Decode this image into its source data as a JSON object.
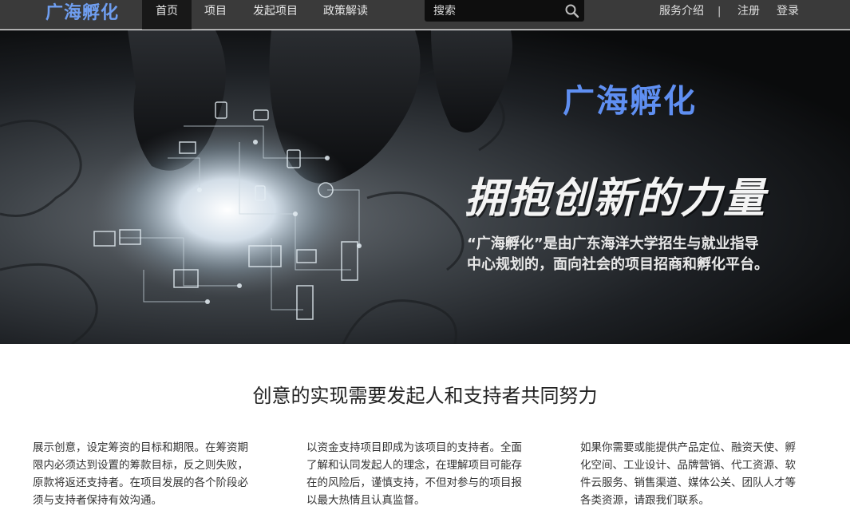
{
  "nav": {
    "logo": "广海孵化",
    "items": [
      {
        "label": "首页",
        "active": true
      },
      {
        "label": "项目",
        "active": false
      },
      {
        "label": "发起项目",
        "active": false
      },
      {
        "label": "政策解读",
        "active": false
      }
    ],
    "search_placeholder": "搜索",
    "right": {
      "about": "服务介绍",
      "divider": "|",
      "register": "注册",
      "login": "登录"
    }
  },
  "hero": {
    "brand": "广海孵化",
    "slogan": "拥抱创新的力量",
    "description_line1": "“广海孵化”是由广东海洋大学招生与就业指导",
    "description_line2": "中心规划的，面向社会的项目招商和孵化平台。"
  },
  "content": {
    "title": "创意的实现需要发起人和支持者共同努力",
    "columns": [
      "展示创意，设定筹资的目标和期限。在筹资期限内必须达到设置的筹款目标，反之则失败，原款将返还支持者。在项目发展的各个阶段必须与支持者保持有效沟通。",
      "以资金支持项目即成为该项目的支持者。全面了解和认同发起人的理念，在理解项目可能存在的风险后，谨慎支持，不但对参与的项目报以最大热情且认真监督。",
      "如果你需要或能提供产品定位、融资天使、孵化空间、工业设计、品牌营销、代工资源、软件云服务、销售渠道、媒体公关、团队人才等各类资源，请跟我们联系。"
    ]
  },
  "colors": {
    "nav_bg": "#3a3a3a",
    "nav_active_bg": "#181818",
    "brand_blue": "#5f8ff2",
    "logo_blue": "#6f9ef0"
  }
}
